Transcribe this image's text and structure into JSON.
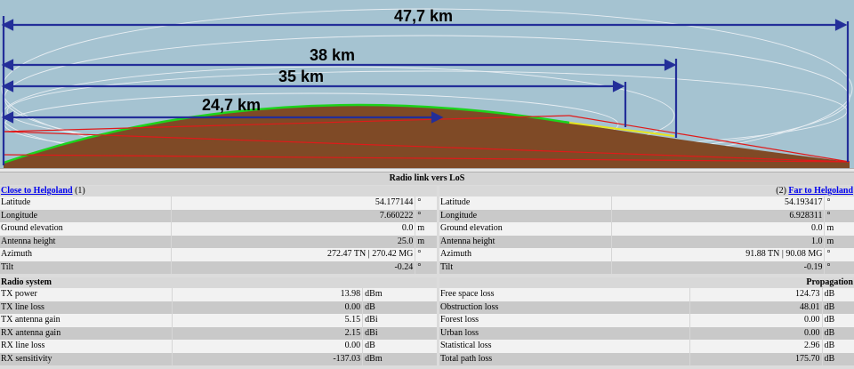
{
  "profile": {
    "distances": [
      "47,7 km",
      "38 km",
      "35 km",
      "24,7 km"
    ],
    "colors": {
      "sky": "#a5c3d1",
      "terrain": "#7f4a26",
      "horizon": "#1dd31d",
      "los_line": "#e01a1a",
      "arrow": "#232e99",
      "ellipse": "#e8eef3"
    }
  },
  "title": "Radio link vers LoS",
  "left_site": {
    "link": "Close to Helgoland",
    "index": "(1)",
    "rows": [
      {
        "label": "Latitude",
        "value": "54.177144",
        "unit": "°"
      },
      {
        "label": "Longitude",
        "value": "7.660222",
        "unit": "°"
      },
      {
        "label": "Ground elevation",
        "value": "0.0",
        "unit": "m"
      },
      {
        "label": "Antenna height",
        "value": "25.0",
        "unit": "m"
      },
      {
        "label": "Azimuth",
        "value": "272.47 TN | 270.42 MG",
        "unit": "°"
      },
      {
        "label": "Tilt",
        "value": "-0.24",
        "unit": "°"
      }
    ]
  },
  "right_site": {
    "link": "Far to Helgoland",
    "index": "(2)",
    "rows": [
      {
        "label": "Latitude",
        "value": "54.193417",
        "unit": "°"
      },
      {
        "label": "Longitude",
        "value": "6.928311",
        "unit": "°"
      },
      {
        "label": "Ground elevation",
        "value": "0.0",
        "unit": "m"
      },
      {
        "label": "Antenna height",
        "value": "1.0",
        "unit": "m"
      },
      {
        "label": "Azimuth",
        "value": "91.88 TN | 90.08 MG",
        "unit": "°"
      },
      {
        "label": "Tilt",
        "value": "-0.19",
        "unit": "°"
      }
    ]
  },
  "radio_system": {
    "header": "Radio system",
    "rows": [
      {
        "label": "TX power",
        "value": "13.98",
        "unit": "dBm"
      },
      {
        "label": "TX line loss",
        "value": "0.00",
        "unit": "dB"
      },
      {
        "label": "TX antenna gain",
        "value": "5.15",
        "unit": "dBi"
      },
      {
        "label": "RX antenna gain",
        "value": "2.15",
        "unit": "dBi"
      },
      {
        "label": "RX line loss",
        "value": "0.00",
        "unit": "dB"
      },
      {
        "label": "RX sensitivity",
        "value": "-137.03",
        "unit": "dBm"
      }
    ]
  },
  "propagation": {
    "header": "Propagation",
    "rows": [
      {
        "label": "Free space loss",
        "value": "124.73",
        "unit": "dB"
      },
      {
        "label": "Obstruction loss",
        "value": "48.01",
        "unit": "dB"
      },
      {
        "label": "Forest loss",
        "value": "0.00",
        "unit": "dB"
      },
      {
        "label": "Urban loss",
        "value": "0.00",
        "unit": "dB"
      },
      {
        "label": "Statistical loss",
        "value": "2.96",
        "unit": "dB"
      },
      {
        "label": "Total path loss",
        "value": "175.70",
        "unit": "dB"
      }
    ]
  }
}
